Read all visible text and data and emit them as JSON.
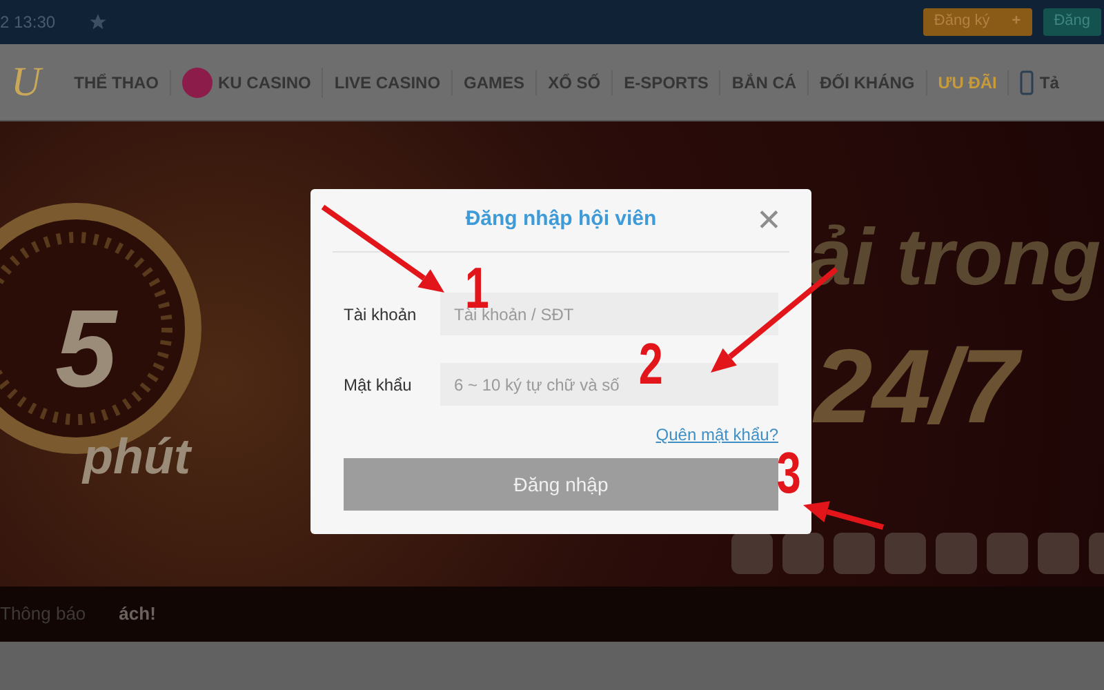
{
  "top_bar": {
    "time": "2 13:30",
    "buttons": [
      {
        "label": "Đăng ký",
        "icon": "+",
        "kind": "register"
      },
      {
        "label": "Đăng",
        "kind": "login"
      }
    ]
  },
  "nav": {
    "logo": "U",
    "items": [
      {
        "label": "THỂ THAO",
        "kind": "plain",
        "highlight": false
      },
      {
        "label": "KU CASINO",
        "kind": "casino",
        "highlight": false
      },
      {
        "label": "LIVE CASINO",
        "kind": "plain",
        "highlight": false
      },
      {
        "label": "GAMES",
        "kind": "plain",
        "highlight": false
      },
      {
        "label": "XỔ SỐ",
        "kind": "plain",
        "highlight": false
      },
      {
        "label": "E-SPORTS",
        "kind": "plain",
        "highlight": false
      },
      {
        "label": "BẮN CÁ",
        "kind": "plain",
        "highlight": false
      },
      {
        "label": "ĐỐI KHÁNG",
        "kind": "plain",
        "highlight": false
      },
      {
        "label": "ƯU ĐÃI",
        "kind": "plain",
        "highlight": true
      },
      {
        "label": "Tả",
        "kind": "app",
        "highlight": false
      }
    ]
  },
  "banner": {
    "texts": [
      "5",
      "phút",
      "ải trong",
      "24/7"
    ]
  },
  "notice": {
    "label": "Thông báo",
    "text": "ách!"
  },
  "modal": {
    "title": "Đăng nhập hội viên",
    "close": "✕",
    "fields": [
      {
        "label": "Tài khoản",
        "placeholder": "Tài khoản / SĐT"
      },
      {
        "label": "Mật khẩu",
        "placeholder": "6 ~ 10 ký tự chữ và số"
      }
    ],
    "forgot_link": "Quên mật khẩu?",
    "submit": "Đăng nhập"
  },
  "annotations": [
    {
      "number": "1"
    },
    {
      "number": "2"
    },
    {
      "number": "3"
    }
  ]
}
